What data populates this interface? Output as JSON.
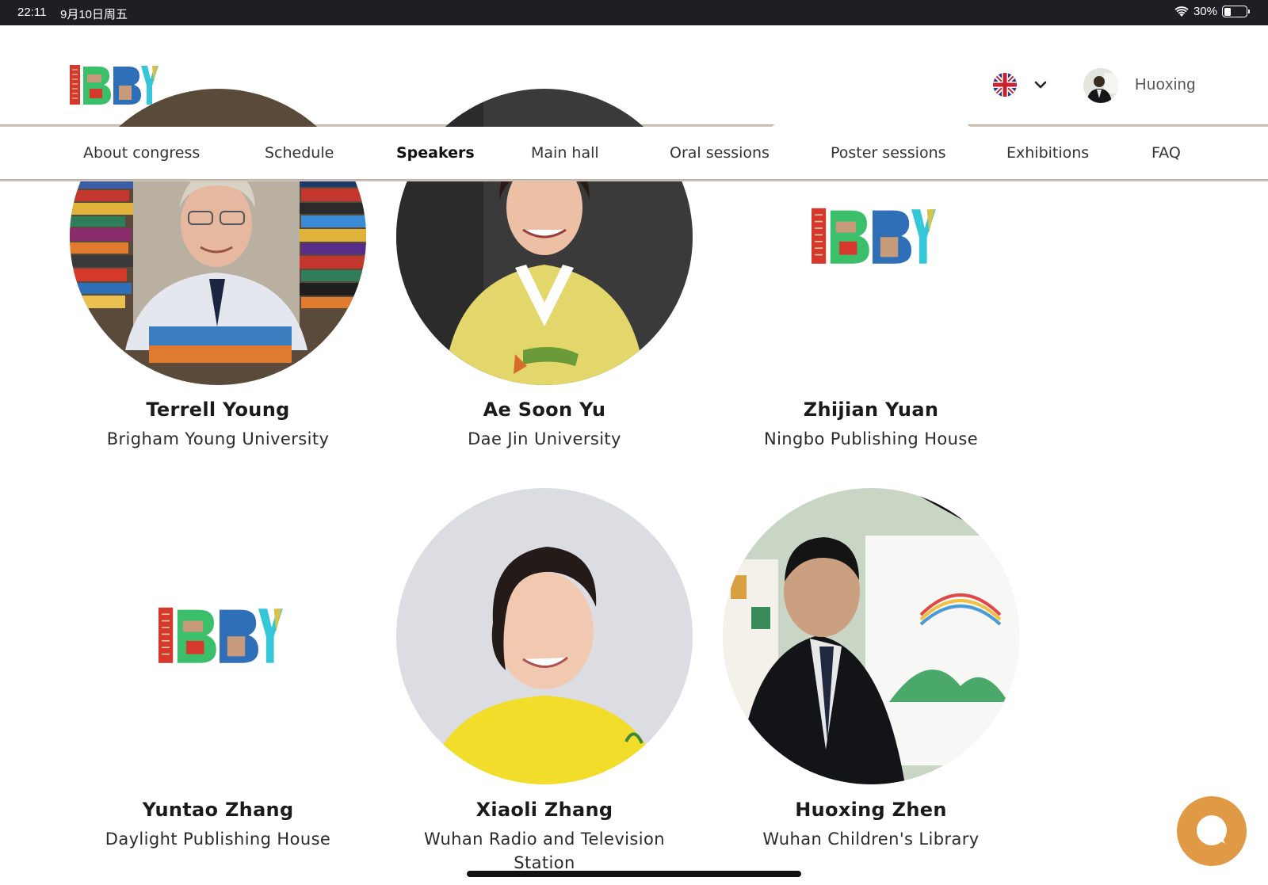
{
  "status_bar": {
    "time": "22:11",
    "date": "9月10日周五",
    "battery": "30%",
    "battery_level": 0.3
  },
  "header": {
    "logo_text": "IBBY",
    "language": "English (UK)",
    "user_name": "Huoxing"
  },
  "nav": {
    "items": [
      {
        "label": "About congress",
        "active": false
      },
      {
        "label": "Schedule",
        "active": false
      },
      {
        "label": "Speakers",
        "active": true
      },
      {
        "label": "Main hall",
        "active": false
      },
      {
        "label": "Oral sessions",
        "active": false
      },
      {
        "label": "Poster sessions",
        "active": false
      },
      {
        "label": "Exhibitions",
        "active": false
      },
      {
        "label": "FAQ",
        "active": false
      }
    ]
  },
  "speakers": [
    {
      "name": "Terrell Young",
      "org": "Brigham Young University",
      "photo": "portrait"
    },
    {
      "name": "Ae Soon Yu",
      "org": "Dae Jin University",
      "photo": "portrait"
    },
    {
      "name": "Zhijian Yuan",
      "org": "Ningbo Publishing House",
      "photo": "ibby-logo"
    },
    {
      "name": "Yuntao Zhang",
      "org": "Daylight Publishing House",
      "photo": "ibby-logo"
    },
    {
      "name": "Xiaoli Zhang",
      "org": "Wuhan Radio and Television Station",
      "photo": "portrait"
    },
    {
      "name": "Huoxing Zhen",
      "org": "Wuhan Children's Library",
      "photo": "portrait"
    }
  ],
  "colors": {
    "accent": "#e09a45",
    "status_bar": "#1e1f24",
    "rule": "#b8ad9f"
  },
  "icons": [
    "wifi-icon",
    "battery-icon",
    "uk-flag-icon",
    "chevron-down-icon",
    "chat-icon"
  ]
}
